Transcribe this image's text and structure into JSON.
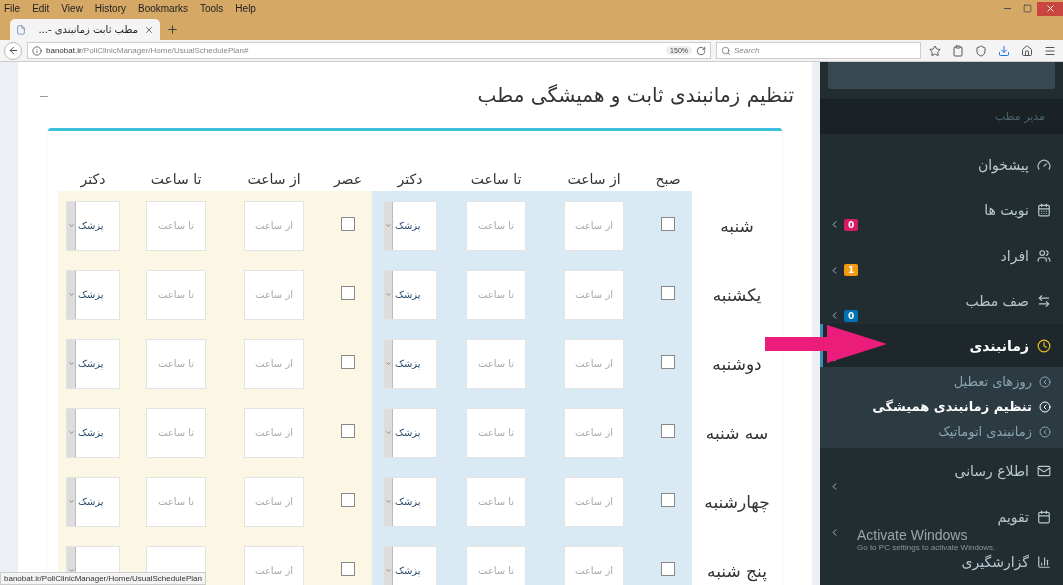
{
  "browser": {
    "menu": {
      "file": "File",
      "edit": "Edit",
      "view": "View",
      "history": "History",
      "bookmarks": "Bookmarks",
      "tools": "Tools",
      "help": "Help"
    },
    "tab": {
      "title": "مطب ثابت زمانبندی -..."
    },
    "address": {
      "url": "**banobat.ir**/PoliClinicManager/Home/UsualSchedulePlan#",
      "zoom": "150%"
    },
    "search": {
      "placeholder": "Search"
    }
  },
  "page": {
    "title": "تنظیم زمانبندی ثابت و همیشگی مطب",
    "collapse": "–",
    "table": {
      "columns": [
        "",
        "صبح",
        "از ساعت",
        "تا ساعت",
        "دکتر",
        "عصر",
        "از ساعت",
        "تا ساعت",
        "دکتر"
      ],
      "rows": [
        {
          "day": "شنبه",
          "morning": {
            "checked": false,
            "from_placeholder": "از ساعت",
            "to_placeholder": "تا ساعت",
            "doctor": "پزشک"
          },
          "evening": {
            "checked": false,
            "from_placeholder": "از ساعت",
            "to_placeholder": "تا ساعت",
            "doctor": "پزشک"
          }
        },
        {
          "day": "یکشنبه",
          "morning": {
            "checked": false,
            "from_placeholder": "از ساعت",
            "to_placeholder": "تا ساعت",
            "doctor": "پزشک"
          },
          "evening": {
            "checked": false,
            "from_placeholder": "از ساعت",
            "to_placeholder": "تا ساعت",
            "doctor": "پزشک"
          }
        },
        {
          "day": "دوشنبه",
          "morning": {
            "checked": false,
            "from_placeholder": "از ساعت",
            "to_placeholder": "تا ساعت",
            "doctor": "پزشک"
          },
          "evening": {
            "checked": false,
            "from_placeholder": "از ساعت",
            "to_placeholder": "تا ساعت",
            "doctor": "پزشک"
          }
        },
        {
          "day": "سه شنبه",
          "morning": {
            "checked": false,
            "from_placeholder": "از ساعت",
            "to_placeholder": "تا ساعت",
            "doctor": "پزشک"
          },
          "evening": {
            "checked": false,
            "from_placeholder": "از ساعت",
            "to_placeholder": "تا ساعت",
            "doctor": "پزشک"
          }
        },
        {
          "day": "چهارشنبه",
          "morning": {
            "checked": false,
            "from_placeholder": "از ساعت",
            "to_placeholder": "تا ساعت",
            "doctor": "پزشک"
          },
          "evening": {
            "checked": false,
            "from_placeholder": "از ساعت",
            "to_placeholder": "تا ساعت",
            "doctor": "پزشک"
          }
        },
        {
          "day": "پنج شنبه",
          "morning": {
            "checked": false,
            "from_placeholder": "از ساعت",
            "to_placeholder": "تا ساعت",
            "doctor": "پزشک"
          },
          "evening": {
            "checked": false,
            "from_placeholder": "از ساعت"
          }
        }
      ]
    }
  },
  "sidebar": {
    "section": "مدیر مطب",
    "items": [
      {
        "label": "پیشخوان",
        "selected": false,
        "expandable": false
      },
      {
        "label": "نوبت ها",
        "selected": false,
        "expandable": true,
        "badge": "0",
        "color": "#d81b60"
      },
      {
        "label": "افراد",
        "selected": false,
        "expandable": true,
        "badge": "1",
        "color": "#f39c12"
      },
      {
        "label": "صف مطب",
        "selected": false,
        "expandable": true,
        "badge": "0",
        "color": "#0073b7"
      },
      {
        "label": "زمانبندی",
        "selected": true,
        "expandable": true,
        "expanded": true,
        "children": [
          {
            "label": "روزهای تعطیل",
            "selected": false
          },
          {
            "label": "تنظیم زمانبندی همیشگی",
            "selected": true
          },
          {
            "label": "زمانبندی اتوماتیک",
            "selected": false
          }
        ]
      },
      {
        "label": "اطلاع رسانی",
        "selected": false,
        "expandable": true
      },
      {
        "label": "تقویم",
        "selected": false,
        "expandable": true
      },
      {
        "label": "گزارشگیری",
        "selected": false,
        "expandable": false
      }
    ]
  },
  "os_notice": {
    "title": "Activate Windows",
    "text": "Go to PC settings to activate Windows."
  },
  "status_bar": {
    "url": "banobat.ir/PoliClinicManager/Home/UsualSchedulePlan"
  }
}
